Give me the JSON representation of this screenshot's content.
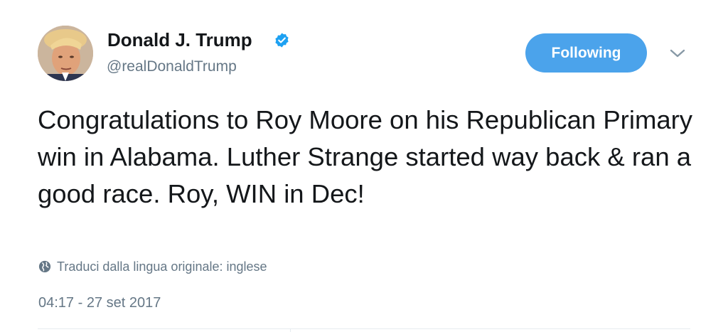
{
  "user": {
    "display_name": "Donald J. Trump",
    "handle": "@realDonaldTrump",
    "verified": true,
    "avatar_icon": "profile-photo"
  },
  "actions": {
    "follow_label": "Following",
    "menu_icon": "chevron-down-icon"
  },
  "tweet": {
    "text": "Congratulations to Roy Moore on his Republican Primary win in Alabama. Luther Strange started way back & ran a good race. Roy, WIN in Dec!",
    "translate_label": "Traduci dalla lingua originale: inglese",
    "timestamp": "04:17 - 27 set 2017"
  },
  "colors": {
    "accent": "#4ba3eb",
    "text_primary": "#14171a",
    "text_secondary": "#657786",
    "verified_badge": "#1da1f2",
    "divider": "#e6ecf0"
  }
}
